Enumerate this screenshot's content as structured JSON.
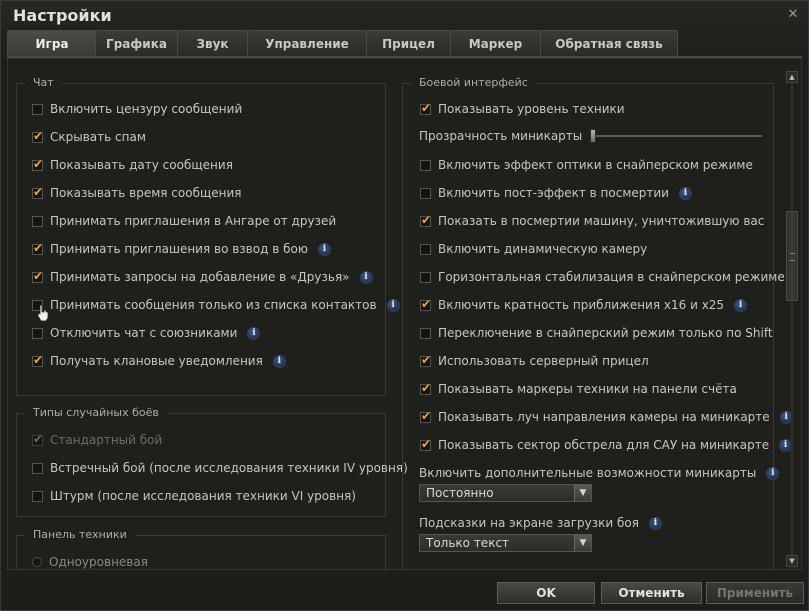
{
  "window": {
    "title": "Настройки",
    "close_glyph": "✕"
  },
  "tabs": [
    {
      "label": "Игра",
      "active": true
    },
    {
      "label": "Графика",
      "active": false
    },
    {
      "label": "Звук",
      "active": false
    },
    {
      "label": "Управление",
      "active": false
    },
    {
      "label": "Прицел",
      "active": false
    },
    {
      "label": "Маркер",
      "active": false
    },
    {
      "label": "Обратная связь",
      "active": false
    }
  ],
  "chat": {
    "title": "Чат",
    "options": [
      {
        "label": "Включить цензуру сообщений",
        "checked": false,
        "info": false
      },
      {
        "label": "Скрывать спам",
        "checked": true,
        "info": false
      },
      {
        "label": "Показывать дату сообщения",
        "checked": true,
        "info": false
      },
      {
        "label": "Показывать время сообщения",
        "checked": true,
        "info": false
      },
      {
        "label": "Принимать приглашения в Ангаре от друзей",
        "checked": false,
        "info": false
      },
      {
        "label": "Принимать приглашения во взвод в бою",
        "checked": true,
        "info": true
      },
      {
        "label": "Принимать запросы на добавление в «Друзья»",
        "checked": true,
        "info": true
      },
      {
        "label": "Принимать сообщения только из списка контактов",
        "checked": false,
        "info": true
      },
      {
        "label": "Отключить чат с союзниками",
        "checked": false,
        "info": true
      },
      {
        "label": "Получать клановые уведомления",
        "checked": true,
        "info": true
      }
    ]
  },
  "battle_types": {
    "title": "Типы случайных боёв",
    "options": [
      {
        "label": "Стандартный бой",
        "checked": true,
        "disabled": true
      },
      {
        "label": "Встречный бой (после исследования техники IV уровня)",
        "checked": false,
        "disabled": false
      },
      {
        "label": "Штурм (после исследования техники VI уровня)",
        "checked": false,
        "disabled": false
      }
    ]
  },
  "vehicle_panel": {
    "title": "Панель техники",
    "radio_label": "Одноуровневая"
  },
  "battle_ui": {
    "title": "Боевой интерфейс",
    "show_tier": {
      "label": "Показывать уровень техники",
      "checked": true
    },
    "minimap_transparency": {
      "label": "Прозрачность миникарты",
      "value": 0.0
    },
    "options": [
      {
        "label": "Включить эффект оптики в снайперском режиме",
        "checked": false,
        "info": false
      },
      {
        "label": "Включить пост-эффект в посмертии",
        "checked": false,
        "info": true
      },
      {
        "label": "Показать в посмертии машину, уничтожившую вас",
        "checked": true,
        "info": false
      },
      {
        "label": "Включить динамическую камеру",
        "checked": false,
        "info": false
      },
      {
        "label": "Горизонтальная стабилизация в снайперском режиме",
        "checked": false,
        "info": false
      },
      {
        "label": "Включить кратность приближения x16 и x25",
        "checked": true,
        "info": true
      },
      {
        "label": "Переключение в снайперский режим только по Shift",
        "checked": false,
        "info": false
      },
      {
        "label": "Использовать серверный прицел",
        "checked": true,
        "info": false
      },
      {
        "label": "Показывать маркеры техники на панели счёта",
        "checked": true,
        "info": false
      },
      {
        "label": "Показывать луч направления камеры на миникарте",
        "checked": true,
        "info": true
      },
      {
        "label": "Показывать сектор обстрела для САУ на миникарте",
        "checked": true,
        "info": true
      }
    ],
    "minimap_extra": {
      "label": "Включить дополнительные возможности миникарты",
      "value": "Постоянно"
    },
    "loading_hints": {
      "label": "Подсказки на экране загрузки боя",
      "value": "Только текст"
    }
  },
  "buttons": {
    "ok": "OK",
    "cancel": "Отменить",
    "apply": "Применить"
  },
  "icons": {
    "info": "info-icon",
    "check": "checkmark-icon",
    "dropdown": "chevron-down-icon"
  },
  "colors": {
    "check_accent": "#f0a53a",
    "info_blue": "#2e4465"
  }
}
